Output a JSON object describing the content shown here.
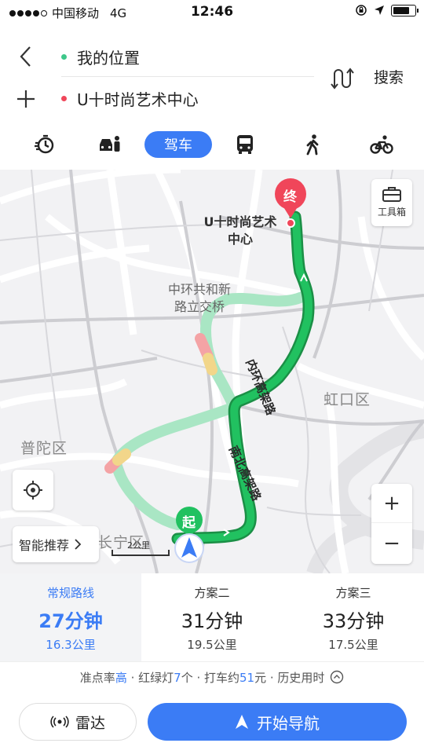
{
  "status_bar": {
    "carrier": "中国移动",
    "network": "4G",
    "time": "12:46"
  },
  "header": {
    "origin": "我的位置",
    "destination": "U十时尚艺术中心",
    "search_label": "搜索",
    "origin_dot_color": "#3ec78a",
    "destination_dot_color": "#f0465a"
  },
  "modes": [
    {
      "icon": "taxi-timer-icon"
    },
    {
      "icon": "car-people-icon"
    },
    {
      "label": "驾车",
      "active": true
    },
    {
      "icon": "bus-icon"
    },
    {
      "icon": "walk-icon"
    },
    {
      "icon": "bike-icon"
    }
  ],
  "map": {
    "districts": {
      "putuo": "普陀区",
      "hongkou": "虹口区",
      "changning": "长宁区"
    },
    "poi_interchange": {
      "line1": "中环共和新",
      "line2": "路立交桥"
    },
    "destination_label": {
      "line1": "U十时尚艺术",
      "line2": "中心"
    },
    "road_inner_ring": "内环高架路",
    "road_nanbei": "南北高架路",
    "start_marker": "起",
    "end_marker": "终",
    "toolbox_label": "工具箱",
    "zoom_in": "+",
    "zoom_out": "−",
    "smart_recommend": "智能推荐",
    "scale": "2公里",
    "route_color": "#1fb85a",
    "alt_route_color": "#a9e6c4",
    "accent": "#3b7cf5"
  },
  "options": [
    {
      "name": "常规路线",
      "time": "27分钟",
      "distance": "16.3公里",
      "active": true
    },
    {
      "name": "方案二",
      "time": "31分钟",
      "distance": "19.5公里"
    },
    {
      "name": "方案三",
      "time": "33分钟",
      "distance": "17.5公里"
    }
  ],
  "info": {
    "accuracy_prefix": "准点率",
    "accuracy_value": "高",
    "lights_prefix": " · 红绿灯",
    "lights_value": "7",
    "lights_unit": "个 · 打车约",
    "taxi_value": "51",
    "taxi_unit": "元 · 历史用时"
  },
  "buttons": {
    "radar": "雷达",
    "navigate": "开始导航"
  }
}
